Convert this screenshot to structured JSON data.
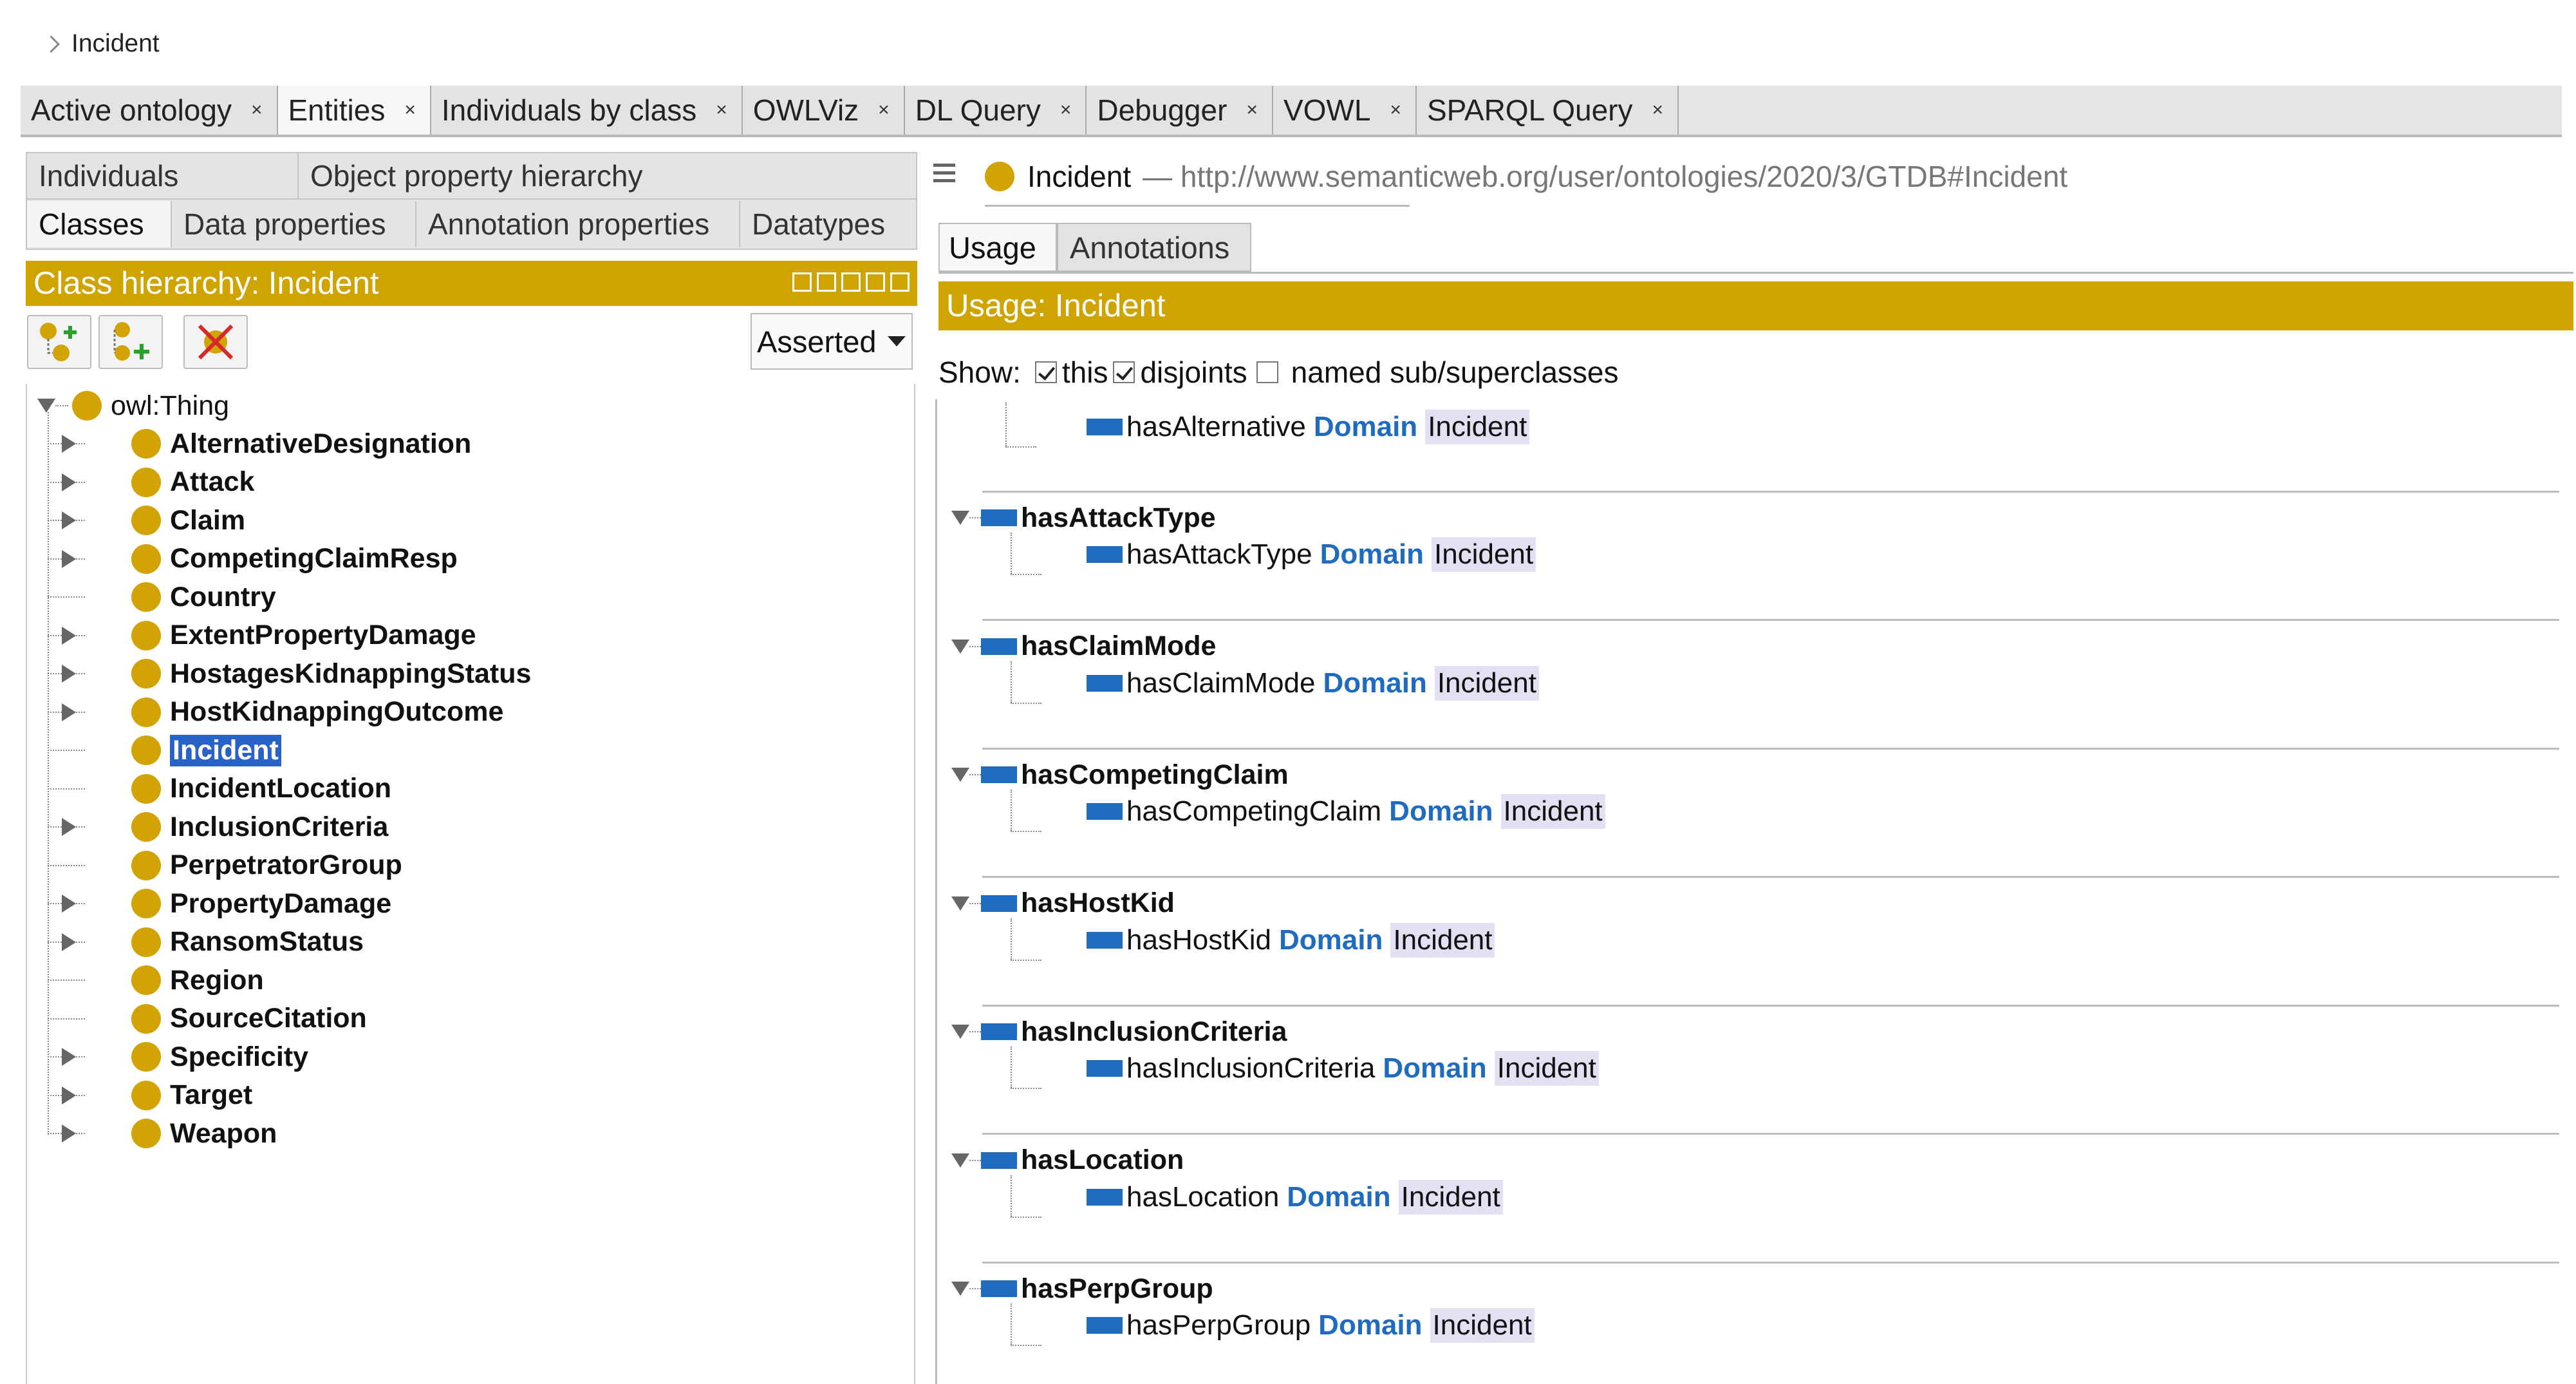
{
  "breadcrumb": "Incident",
  "main_tabs": [
    {
      "label": "Active ontology",
      "close": "×"
    },
    {
      "label": "Entities",
      "close": "×"
    },
    {
      "label": "Individuals by class",
      "close": "×"
    },
    {
      "label": "OWLViz",
      "close": "×"
    },
    {
      "label": "DL Query",
      "close": "×"
    },
    {
      "label": "Debugger",
      "close": "×"
    },
    {
      "label": "VOWL",
      "close": "×"
    },
    {
      "label": "SPARQL Query",
      "close": "×"
    }
  ],
  "sub_tabs": {
    "row1": [
      "Individuals",
      "Object property hierarchy"
    ],
    "row2": [
      "Classes",
      "Data properties",
      "Annotation properties",
      "Datatypes"
    ]
  },
  "class_hierarchy": {
    "title": "Class hierarchy: Incident",
    "mode": "Asserted",
    "root": "owl:Thing",
    "items": [
      "AlternativeDesignation",
      "Attack",
      "Claim",
      "CompetingClaimResp",
      "Country",
      "ExtentPropertyDamage",
      "HostagesKidnappingStatus",
      "HostKidnappingOutcome",
      "Incident",
      "IncidentLocation",
      "InclusionCriteria",
      "PerpetratorGroup",
      "PropertyDamage",
      "RansomStatus",
      "Region",
      "SourceCitation",
      "Specificity",
      "Target",
      "Weapon"
    ]
  },
  "entity": {
    "name": "Incident",
    "iri": "— http://www.semanticweb.org/user/ontologies/2020/3/GTDB#Incident"
  },
  "usage_tabs": [
    "Usage",
    "Annotations"
  ],
  "usage": {
    "title": "Usage: Incident",
    "show_label": "Show:",
    "opt_this": "this",
    "opt_disjoints": "disjoints",
    "opt_named": "named sub/superclasses",
    "domain_kw": "Domain",
    "target": "Incident",
    "first_item": "hasAlternative",
    "groups": [
      "hasAttackType",
      "hasClaimMode",
      "hasCompetingClaim",
      "hasHostKid",
      "hasInclusionCriteria",
      "hasLocation",
      "hasPerpGroup"
    ]
  },
  "colors": {
    "accent_gold": "#cfa300",
    "selection_blue": "#2a63c8",
    "property_blue": "#1f6bbf"
  }
}
